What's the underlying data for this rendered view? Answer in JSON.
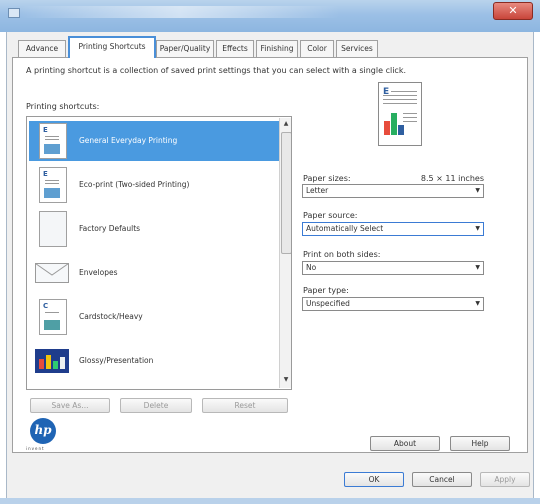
{
  "window": {
    "close_symbol": "✕"
  },
  "tabs": [
    {
      "label": "Advance"
    },
    {
      "label": "Printing Shortcuts"
    },
    {
      "label": "Paper/Quality"
    },
    {
      "label": "Effects"
    },
    {
      "label": "Finishing"
    },
    {
      "label": "Color"
    },
    {
      "label": "Services"
    }
  ],
  "description": "A printing shortcut is a collection of saved print settings that you can select with a single click.",
  "shortcuts_label": "Printing shortcuts:",
  "shortcuts": [
    {
      "label": "General Everyday Printing",
      "icon": "document-icon",
      "selected": true
    },
    {
      "label": "Eco-print (Two-sided Printing)",
      "icon": "document-icon"
    },
    {
      "label": "Factory Defaults",
      "icon": "blank-page-icon"
    },
    {
      "label": "Envelopes",
      "icon": "envelope-icon"
    },
    {
      "label": "Cardstock/Heavy",
      "icon": "cardstock-icon"
    },
    {
      "label": "Glossy/Presentation",
      "icon": "presentation-icon"
    }
  ],
  "list_buttons": {
    "save_as": "Save As...",
    "delete": "Delete",
    "reset": "Reset"
  },
  "settings": {
    "paper_size_label": "Paper sizes:",
    "paper_size_dims": "8.5 × 11 inches",
    "paper_size_value": "Letter",
    "paper_source_label": "Paper source:",
    "paper_source_value": "Automatically Select",
    "print_both_label": "Print on both sides:",
    "print_both_value": "No",
    "paper_type_label": "Paper type:",
    "paper_type_value": "Unspecified"
  },
  "footer": {
    "about": "About",
    "help": "Help",
    "ok": "OK",
    "cancel": "Cancel",
    "apply": "Apply"
  },
  "brand": {
    "logo_text": "hp",
    "logo_sub": "invent",
    "color": "#1f64b4"
  },
  "accent_color": "#4a9ae0"
}
